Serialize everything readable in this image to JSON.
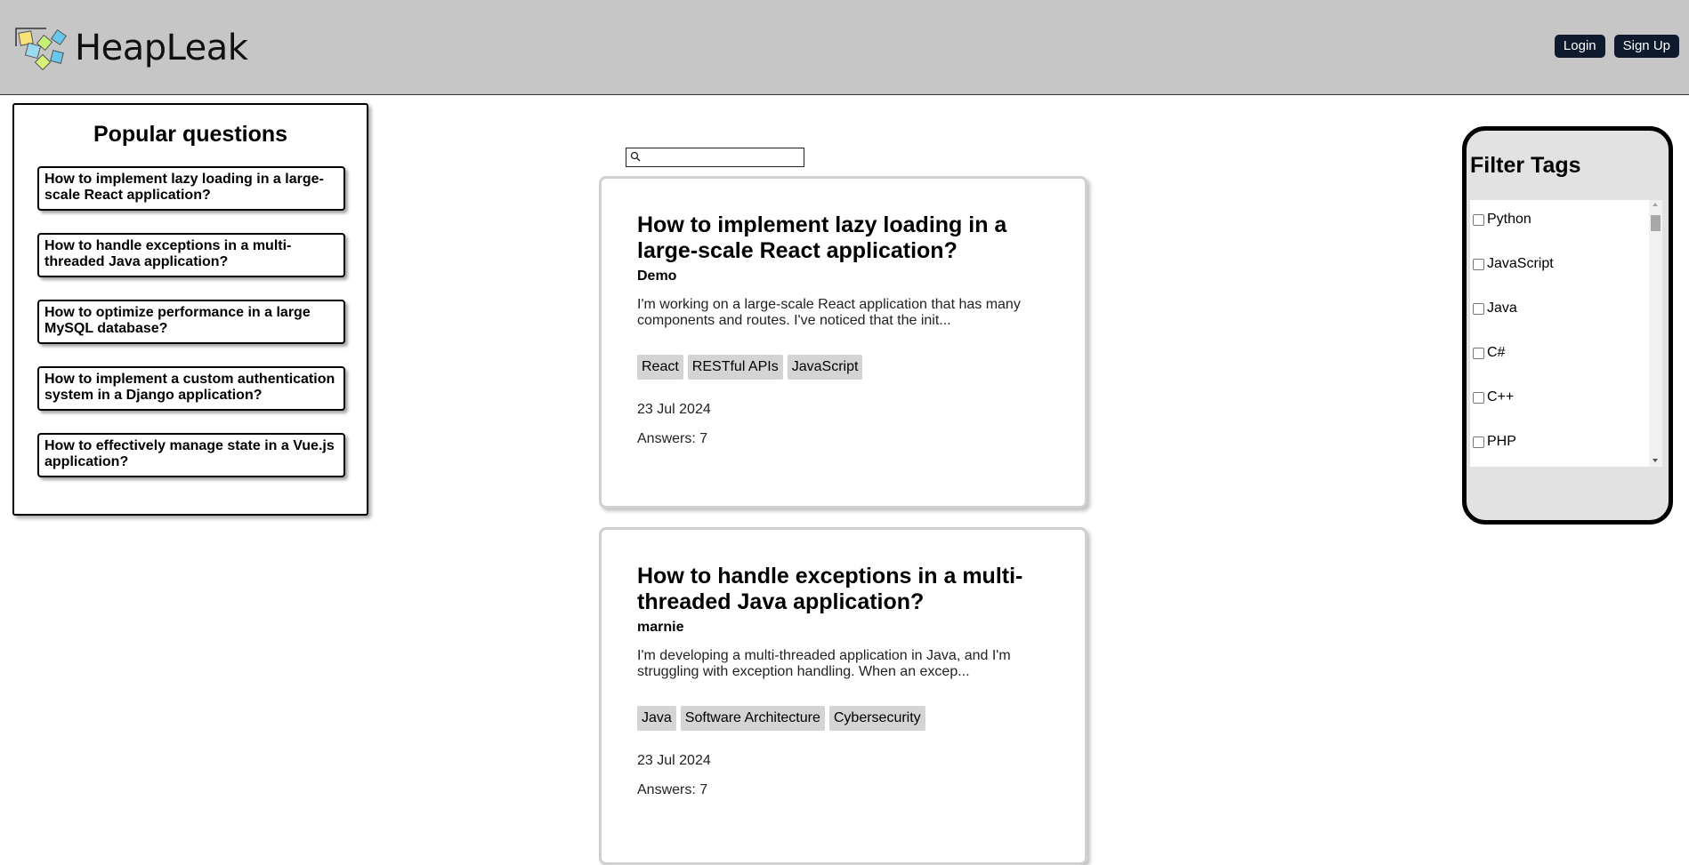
{
  "header": {
    "brand": "HeapLeak",
    "login_label": "Login",
    "signup_label": "Sign Up"
  },
  "popular": {
    "title": "Popular questions",
    "items": [
      "How to implement lazy loading in a large-scale React application?",
      "How to handle exceptions in a multi-threaded Java application?",
      "How to optimize performance in a large MySQL database?",
      "How to implement a custom authentication system in a Django application?",
      "How to effectively manage state in a Vue.js application?"
    ]
  },
  "search": {
    "value": "",
    "placeholder": ""
  },
  "questions": [
    {
      "title": "How to implement lazy loading in a large-scale React application?",
      "author": "Demo",
      "excerpt": "I'm working on a large-scale React application that has many components and routes. I've noticed that the init...",
      "tags": [
        "React",
        "RESTful APIs",
        "JavaScript"
      ],
      "date": "23 Jul 2024",
      "answers": "Answers: 7"
    },
    {
      "title": "How to handle exceptions in a multi-threaded Java application?",
      "author": "marnie",
      "excerpt": "I'm developing a multi-threaded application in Java, and I'm struggling with exception handling. When an excep...",
      "tags": [
        "Java",
        "Software Architecture",
        "Cybersecurity"
      ],
      "date": "23 Jul 2024",
      "answers": "Answers: 7"
    }
  ],
  "filter": {
    "title": "Filter Tags",
    "tags": [
      "Python",
      "JavaScript",
      "Java",
      "C#",
      "C++",
      "PHP"
    ]
  },
  "colors": {
    "header_bg": "#c6c6c6",
    "button_bg": "#0f1a2e",
    "tag_bg": "#d4d4d4",
    "filter_bg": "#e2e2e2"
  }
}
